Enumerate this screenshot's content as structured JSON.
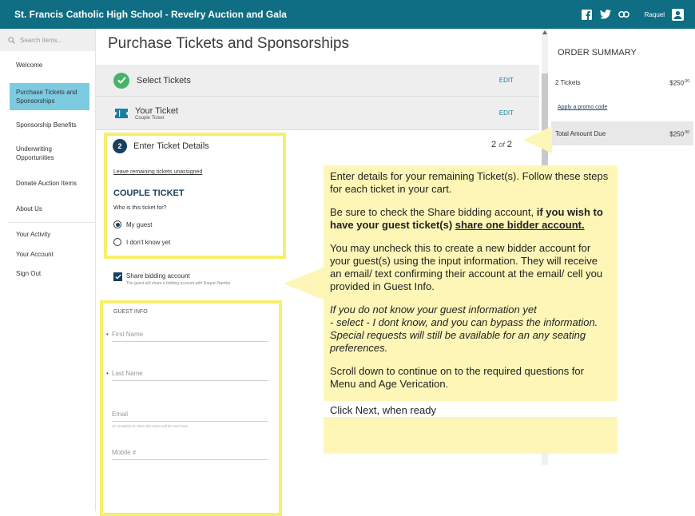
{
  "header": {
    "title": "St. Francis Catholic High School - Revelry Auction and Gala",
    "user_name": "Raquel",
    "icons": [
      "facebook-icon",
      "twitter-icon",
      "link-icon",
      "user-icon"
    ]
  },
  "sidebar": {
    "search_placeholder": "Search items...",
    "items": [
      {
        "label": "Welcome"
      },
      {
        "label": "Purchase Tickets and Sponsorships"
      },
      {
        "label": "Sponsorship Benefits"
      },
      {
        "label": "Underwriting Opportunities"
      },
      {
        "label": "Donate Auction Items"
      },
      {
        "label": "About Us"
      },
      {
        "label": "Your Activity"
      },
      {
        "label": "Your Account"
      },
      {
        "label": "Sign Out"
      }
    ]
  },
  "main": {
    "page_title": "Purchase Tickets and Sponsorships",
    "steps": {
      "select_tickets": {
        "label": "Select Tickets",
        "edit": "EDIT"
      },
      "your_ticket": {
        "label": "Your Ticket",
        "sublabel": "Couple Ticket",
        "edit": "EDIT"
      },
      "enter_details": {
        "number": "2",
        "label": "Enter Ticket Details",
        "count_current": "2",
        "count_of": "of",
        "count_total": "2"
      }
    },
    "leave_unassigned": "Leave remaining tickets unassigned",
    "ticket_type": "COUPLE TICKET",
    "who_for_label": "Who is this ticket for?",
    "options": {
      "my_guest": "My guest",
      "dont_know": "I don't know yet"
    },
    "share": {
      "label": "Share bidding account",
      "hint": "The guest will share a bidding account with Raquel Namba"
    },
    "guest_info": {
      "heading": "GUEST INFO",
      "first_name": "First Name",
      "last_name": "Last Name",
      "email": "Email",
      "email_hint": "An invitation to claim this ticket will be sent here.",
      "mobile": "Mobile #"
    }
  },
  "summary": {
    "title": "ORDER SUMMARY",
    "tickets_label": "2 Tickets",
    "tickets_amount": "$250",
    "tickets_cents": ".00",
    "promo": "Apply a promo code",
    "total_label": "Total Amount Due",
    "total_amount": "$250",
    "total_cents": ".00"
  },
  "callout": {
    "p1": "Enter details for your remaining Ticket(s). Follow these steps for each ticket in your cart.",
    "p2a": "Be sure to check the Share bidding account, ",
    "p2b": "if you wish to have your guest ticket(s) ",
    "p2c": "share one bidder account. ",
    "p3": "You may uncheck this to create a new bidder account for your guest(s) using the input information. They will receive an email/ text confirming their account at the email/ cell you provided in Guest Info.",
    "p4a": "If you do not know your guest information yet",
    "p4b": "- select  - I dont know, and you can bypass the information. Special requests will still be available for an any seating preferences.",
    "p5": "Scroll down to continue on to the required questions for Menu and Age Verication.",
    "p6": "Click Next, when ready"
  },
  "colors": {
    "header": "#0f6e84",
    "highlight": "#f7ef6a",
    "callout": "#fdf6b7",
    "active_nav": "#7dcbe0",
    "check": "#47b36a",
    "step_number": "#173f5f"
  }
}
